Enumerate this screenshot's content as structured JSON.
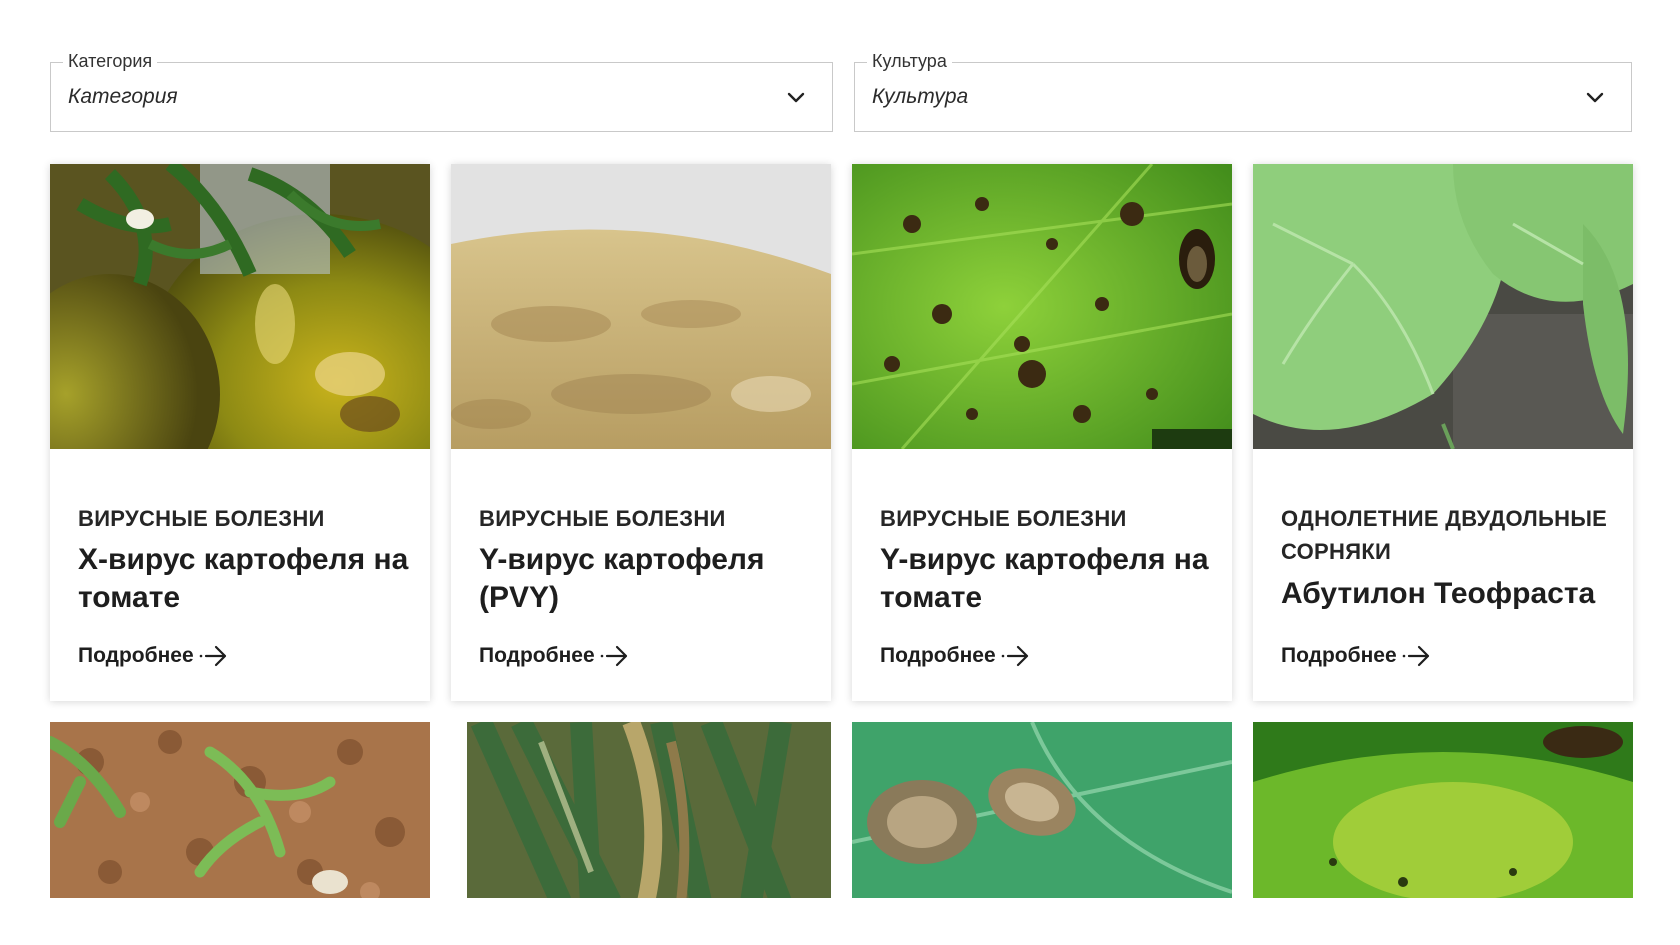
{
  "filters": [
    {
      "legend": "Категория",
      "value": "Категория",
      "icon": "chevron-down-icon"
    },
    {
      "legend": "Культура",
      "value": "Культура",
      "icon": "chevron-down-icon"
    }
  ],
  "cards": [
    {
      "category": "Вирусные болезни",
      "title": "Х-вирус картофеля на томате",
      "more": "Подробнее",
      "image": "tomato-fruit-photo"
    },
    {
      "category": "Вирусные болезни",
      "title": "Y-вирус картофеля (PVY)",
      "more": "Подробнее",
      "image": "potato-tuber-photo"
    },
    {
      "category": "Вирусные болезни",
      "title": "Y-вирус картофеля на томате",
      "more": "Подробнее",
      "image": "spotted-leaf-photo"
    },
    {
      "category": "Однолетние двудольные сорняки",
      "title": "Абутилон Теофраста",
      "more": "Подробнее",
      "image": "abutilon-seedling-photo"
    }
  ],
  "cards_row2": [
    {
      "image": "weed-seedlings-on-soil-photo"
    },
    {
      "image": "onion-leaves-photo"
    },
    {
      "image": "leaf-lesions-photo"
    },
    {
      "image": "yellowing-leaf-photo"
    }
  ],
  "colors": {
    "accent": "#1e1e1e",
    "border": "#c9c9c9"
  }
}
